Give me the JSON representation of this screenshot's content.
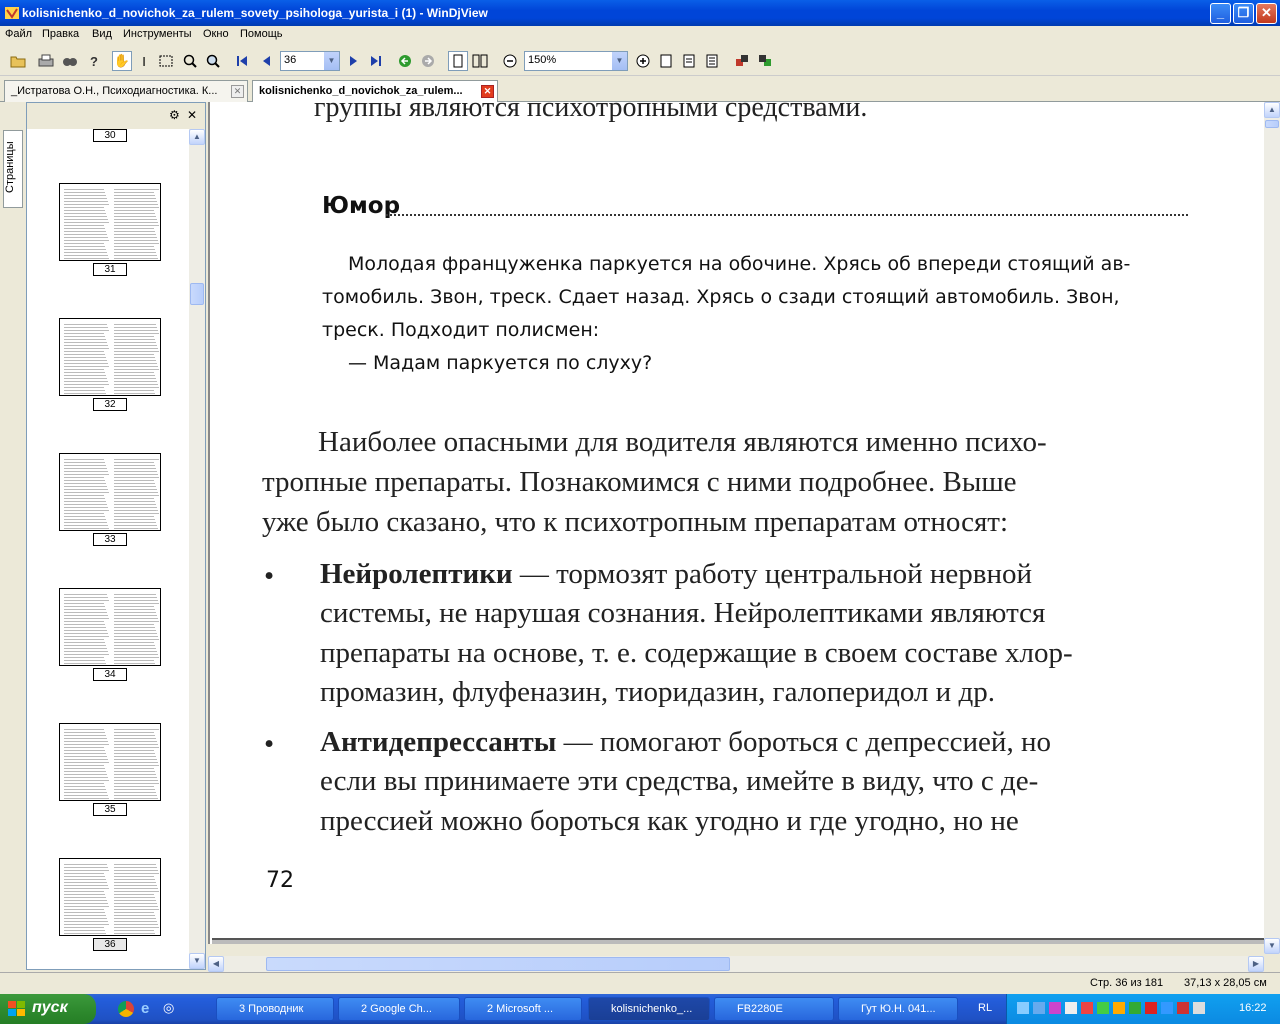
{
  "window": {
    "title": "kolisnichenko_d_novichok_za_rulem_sovety_psihologa_yurista_i (1) - WinDjView",
    "btn_min": "_",
    "btn_max": "❐",
    "btn_close": "✕"
  },
  "menu": [
    "Файл",
    "Правка",
    "Вид",
    "Инструменты",
    "Окно",
    "Помощь"
  ],
  "toolbar": {
    "page_value": "36",
    "zoom_value": "150%"
  },
  "tabs": [
    {
      "label": "_Истратова О.Н., Психодиагностика. К...",
      "active": false
    },
    {
      "label": "kolisnichenko_d_novichok_za_rulem...",
      "active": true
    }
  ],
  "sidebar": {
    "tab_label": "Страницы",
    "pages": [
      "30",
      "31",
      "32",
      "33",
      "34",
      "35",
      "36"
    ]
  },
  "document": {
    "top_line": "группы являются психотропными средствами.",
    "humor_heading": "Юмор",
    "humor_lines": [
      "Молодая француженка паркуется на обочине. Хрясь об впереди стоящий ав-",
      "томобиль. Звон, треск. Сдает назад. Хрясь о сзади стоящий автомобиль. Звон,",
      "треск. Подходит полисмен:",
      "— Мадам паркуется по слуху?"
    ],
    "para_lines": [
      "Наиболее опасными для водителя являются именно психо-",
      "тропные препараты. Познакомимся с ними подробнее. Выше",
      "уже было сказано, что к психотропным препаратам относят:"
    ],
    "bullet1_bold": "Нейролептики",
    "bullet1_lines": [
      " — тормозят работу центральной нервной",
      "системы, не нарушая сознания. Нейролептиками являются",
      "препараты на основе, т. е. содержащие в своем составе хлор-",
      "промазин, флуфеназин, тиоридазин, галоперидол и др."
    ],
    "bullet2_bold": "Антидепрессанты",
    "bullet2_lines": [
      " — помогают бороться с депрессией, но",
      "если вы принимаете эти средства, имейте в виду, что с де-",
      "прессией можно бороться как угодно и где угодно, но не"
    ],
    "page_number": "72"
  },
  "status": {
    "page_info": "Стр. 36 из 181",
    "page_size": "37,13 x 28,05 см"
  },
  "taskbar": {
    "start": "пуск",
    "tasks": [
      {
        "label": "3 Проводник",
        "active": false
      },
      {
        "label": "2 Google Ch...",
        "active": false
      },
      {
        "label": "2 Microsoft ...",
        "active": false
      },
      {
        "label": "kolisnichenko_...",
        "active": true
      },
      {
        "label": "FB2280E",
        "active": false
      },
      {
        "label": "Гут Ю.Н. 041...",
        "active": false
      }
    ],
    "lang": "RL",
    "clock": "16:22"
  }
}
